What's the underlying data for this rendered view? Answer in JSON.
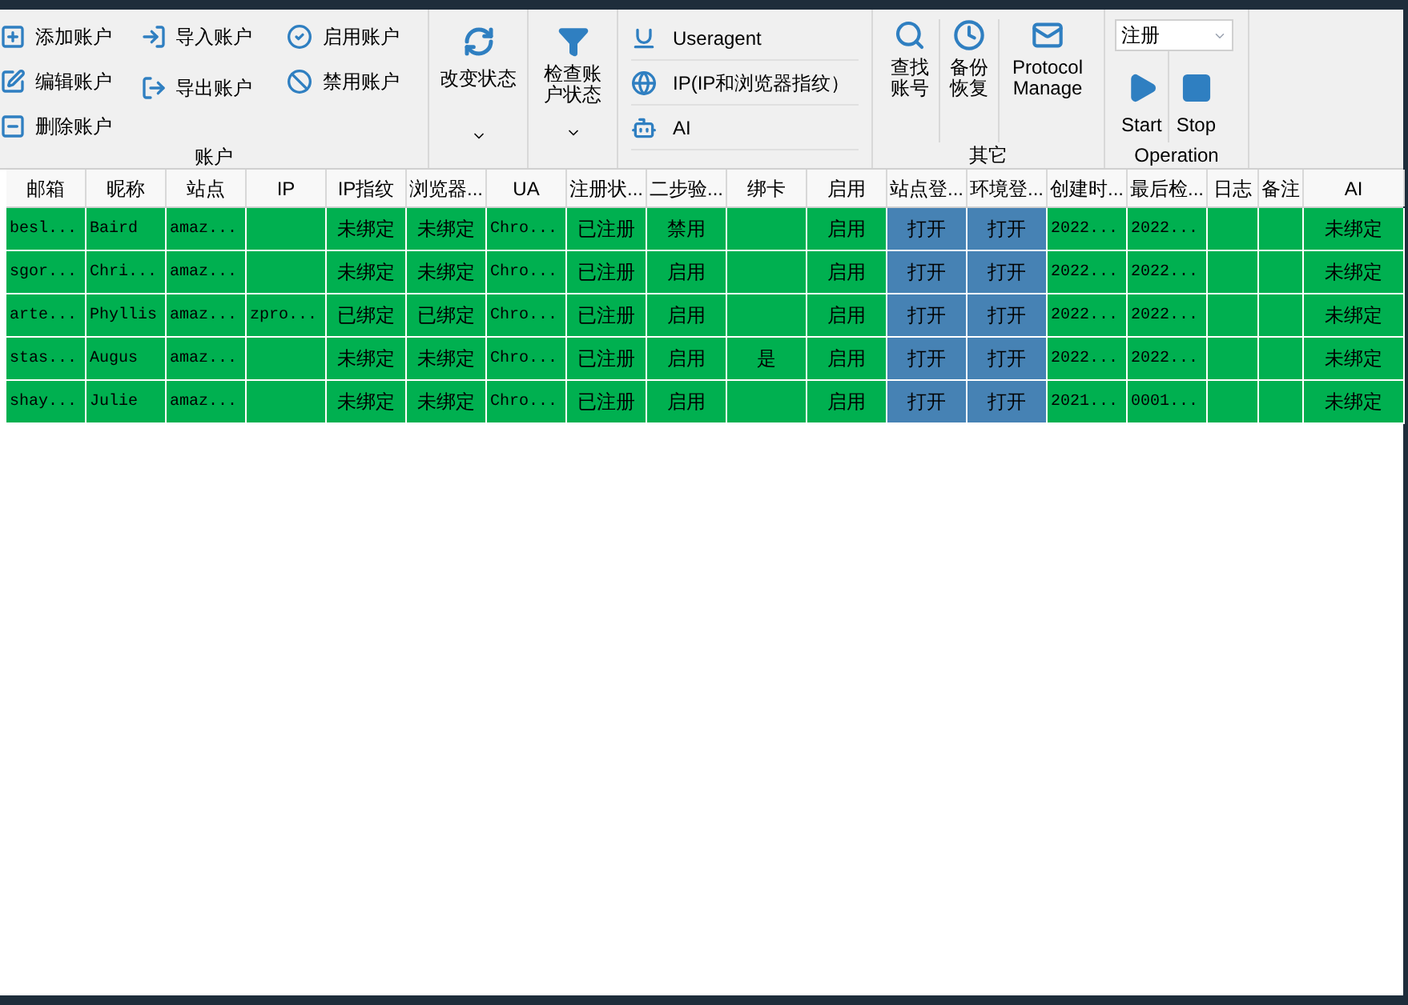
{
  "toolbar": {
    "account_group": {
      "label": "账户",
      "buttons": [
        {
          "label": "添加账户"
        },
        {
          "label": "编辑账户"
        },
        {
          "label": "删除账户"
        },
        {
          "label": "导入账户"
        },
        {
          "label": "导出账户"
        },
        {
          "label": "启用账户"
        },
        {
          "label": "禁用账户"
        }
      ]
    },
    "change_status": {
      "label": "改变状态"
    },
    "check_status": {
      "label": "检查账户状态"
    },
    "ua_group": {
      "items": [
        {
          "label": "Useragent"
        },
        {
          "label": "IP(IP和浏览器指纹）"
        },
        {
          "label": "AI"
        }
      ]
    },
    "other_group": {
      "label": "其它",
      "buttons": [
        {
          "label": "查找账号"
        },
        {
          "label": "备份恢复"
        },
        {
          "label": "Protocol Manage"
        }
      ]
    },
    "operation_group": {
      "label": "Operation",
      "select": {
        "value": "注册"
      },
      "buttons": [
        {
          "label": "Start"
        },
        {
          "label": "Stop"
        }
      ]
    }
  },
  "table": {
    "columns": [
      {
        "label": "邮箱",
        "kind": "mono"
      },
      {
        "label": "昵称",
        "kind": "mono"
      },
      {
        "label": "站点",
        "kind": "mono"
      },
      {
        "label": "IP",
        "kind": "mono"
      },
      {
        "label": "IP指纹",
        "kind": "text"
      },
      {
        "label": "浏览器...",
        "kind": "text"
      },
      {
        "label": "UA",
        "kind": "mono"
      },
      {
        "label": "注册状...",
        "kind": "text"
      },
      {
        "label": "二步验...",
        "kind": "text"
      },
      {
        "label": "绑卡",
        "kind": "text"
      },
      {
        "label": "启用",
        "kind": "text"
      },
      {
        "label": "站点登...",
        "kind": "button"
      },
      {
        "label": "环境登...",
        "kind": "button"
      },
      {
        "label": "创建时...",
        "kind": "mono"
      },
      {
        "label": "最后检...",
        "kind": "mono"
      },
      {
        "label": "日志",
        "kind": "text"
      },
      {
        "label": "备注",
        "kind": "text"
      },
      {
        "label": "AI",
        "kind": "text"
      }
    ],
    "rows": [
      [
        "besl...",
        "Baird",
        "amaz...",
        null,
        "未绑定",
        "未绑定",
        "Chro...",
        "已注册",
        "禁用",
        null,
        "启用",
        "打开",
        "打开",
        "2022...",
        "2022...",
        null,
        null,
        "未绑定"
      ],
      [
        "sgor...",
        "Chri...",
        "amaz...",
        null,
        "未绑定",
        "未绑定",
        "Chro...",
        "已注册",
        "启用",
        null,
        "启用",
        "打开",
        "打开",
        "2022...",
        "2022...",
        null,
        null,
        "未绑定"
      ],
      [
        "arte...",
        "Phyllis",
        "amaz...",
        "zpro...",
        "已绑定",
        "已绑定",
        "Chro...",
        "已注册",
        "启用",
        null,
        "启用",
        "打开",
        "打开",
        "2022...",
        "2022...",
        null,
        null,
        "未绑定"
      ],
      [
        "stas...",
        "Augus",
        "amaz...",
        null,
        "未绑定",
        "未绑定",
        "Chro...",
        "已注册",
        "启用",
        "是",
        "启用",
        "打开",
        "打开",
        "2022...",
        "2022...",
        null,
        null,
        "未绑定"
      ],
      [
        "shay...",
        "Julie",
        "amaz...",
        null,
        "未绑定",
        "未绑定",
        "Chro...",
        "已注册",
        "启用",
        null,
        "启用",
        "打开",
        "打开",
        "2021...",
        "0001...",
        null,
        null,
        "未绑定"
      ]
    ]
  }
}
